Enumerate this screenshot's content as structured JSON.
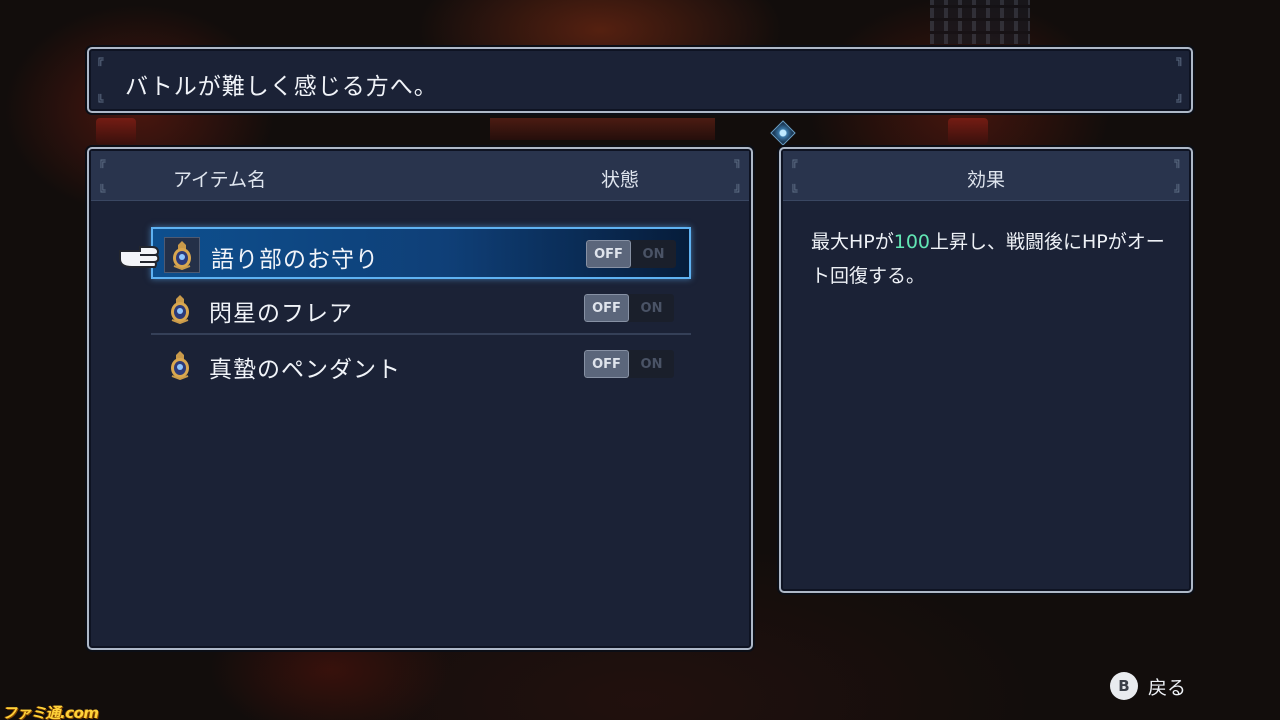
{
  "message": "バトルが難しく感じる方へ。",
  "items_panel": {
    "header_name": "アイテム名",
    "header_status": "状態",
    "items": [
      {
        "name": "語り部のお守り",
        "off_label": "OFF",
        "on_label": "ON",
        "state": "OFF",
        "selected": true,
        "icon": "amulet-icon"
      },
      {
        "name": "閃星のフレア",
        "off_label": "OFF",
        "on_label": "ON",
        "state": "OFF",
        "selected": false,
        "icon": "amulet-icon"
      },
      {
        "name": "真蟄のペンダント",
        "off_label": "OFF",
        "on_label": "ON",
        "state": "OFF",
        "selected": false,
        "icon": "amulet-icon"
      }
    ]
  },
  "effect_panel": {
    "header": "効果",
    "text_before": "最大HPが",
    "text_highlight": "100",
    "text_after": "上昇し、戦闘後にHPがオート回復する。"
  },
  "footer": {
    "button_glyph": "B",
    "back_label": "戻る"
  },
  "watermark": "ファミ通.com",
  "colors": {
    "panel_bg": "#1b2236",
    "header_bg": "#29344d",
    "selection": "#0d4f8e",
    "highlight_number": "#62e6b4"
  }
}
